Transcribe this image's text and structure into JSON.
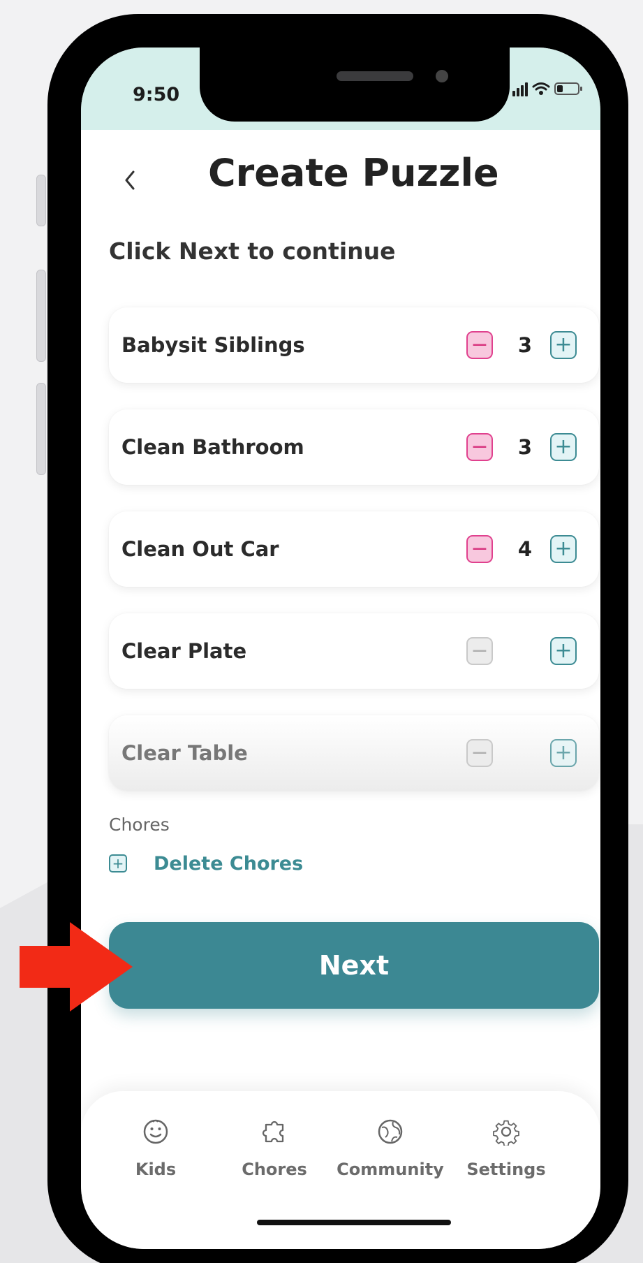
{
  "status_bar": {
    "time": "9:50"
  },
  "header": {
    "back_icon": "chevron-left-icon",
    "title": "Create Puzzle"
  },
  "instructions": "Click Next to continue",
  "chores": [
    {
      "label": "Babysit Siblings",
      "quantity": "3",
      "minus_enabled": true
    },
    {
      "label": "Clean Bathroom",
      "quantity": "3",
      "minus_enabled": true
    },
    {
      "label": "Clean Out Car",
      "quantity": "4",
      "minus_enabled": true
    },
    {
      "label": "Clear Plate",
      "quantity": "",
      "minus_enabled": false
    },
    {
      "label": "Clear Table",
      "quantity": "",
      "minus_enabled": false
    }
  ],
  "section": {
    "label": "Chores",
    "delete_label": "Delete Chores"
  },
  "next_button": {
    "label": "Next"
  },
  "tabs": [
    {
      "label": "Kids",
      "icon": "smiley-face-icon"
    },
    {
      "label": "Chores",
      "icon": "puzzle-piece-icon"
    },
    {
      "label": "Community",
      "icon": "globe-icon"
    },
    {
      "label": "Settings",
      "icon": "gear-icon"
    }
  ],
  "colors": {
    "accent": "#3c8893",
    "status_bar_bg": "#d5efeb",
    "minus_active": "#e0418e",
    "arrow": "#f22a16"
  }
}
